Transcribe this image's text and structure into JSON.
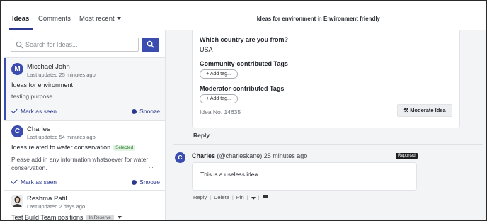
{
  "topbar": {
    "tabs": [
      {
        "label": "Ideas"
      },
      {
        "label": "Comments"
      },
      {
        "label": "Most recent"
      }
    ],
    "breadcrumb": {
      "page": "Ideas for environment",
      "in": "in",
      "group": "Environment friendly"
    }
  },
  "search": {
    "placeholder": "Search for Ideas...",
    "value": ""
  },
  "ideas": [
    {
      "avatar_letter": "M",
      "author": "Micchael John",
      "updated": "Last updated 25 minutes ago",
      "title": "Ideas for environment",
      "body": "testing purpose",
      "mark_label": "Mark as seen",
      "snooze_label": "Snooze"
    },
    {
      "avatar_letter": "C",
      "author": "Charles",
      "updated": "Last updated 54 minutes ago",
      "title": "Ideas related to water conservation",
      "badge": "Selected",
      "body": "Please add in any information whatsoever for water conservation.",
      "ellipsis": "...",
      "mark_label": "Mark as seen",
      "snooze_label": "Snooze"
    },
    {
      "author": "Reshma Patil",
      "updated": "Last updated 2 days ago",
      "title": "Test Build Team positions",
      "badge": "In Reserve"
    }
  ],
  "detail": {
    "country_label": "Which country are you from?",
    "country_value": "USA",
    "community_tags_label": "Community-contributed Tags",
    "moderator_tags_label": "Moderator-contributed Tags",
    "add_tag_label": "+ Add tag...",
    "idea_no": "Idea No. 14635",
    "moderate_label": "Moderate Idea",
    "reply_label": "Reply"
  },
  "comment": {
    "avatar_letter": "C",
    "author": "Charles",
    "handle": "(@charleskane)",
    "time": "25 minutes ago",
    "reported_label": "Reported",
    "text": "This is a useless idea.",
    "actions": {
      "reply": "Reply",
      "delete": "Delete",
      "pin": "Pin"
    }
  },
  "colors": {
    "accent": "#3a4cb0",
    "selected_bg": "#e3f4e4",
    "panel_bg": "#f3f4f6"
  },
  "icons": [
    "search-icon",
    "check-icon",
    "clock-icon",
    "sort-icon",
    "flag-icon",
    "hammer-icon",
    "chevron-down-icon"
  ]
}
